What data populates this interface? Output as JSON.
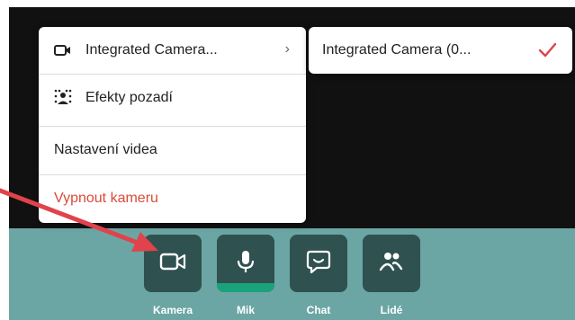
{
  "menu": {
    "items": [
      {
        "label": "Integrated Camera...",
        "icon": "camera-icon",
        "chevron": "›"
      },
      {
        "label": "Efekty pozadí",
        "icon": "background-effects-icon"
      },
      {
        "label": "Nastavení videa"
      },
      {
        "label": "Vypnout kameru"
      }
    ]
  },
  "submenu": {
    "selected_label": "Integrated Camera (0...",
    "check_icon": "checkmark-icon",
    "check_color": "#e0434b"
  },
  "controls": [
    {
      "label": "Kamera",
      "icon": "camera-icon"
    },
    {
      "label": "Mik",
      "icon": "microphone-icon",
      "active": true
    },
    {
      "label": "Chat",
      "icon": "chat-icon"
    },
    {
      "label": "Lidé",
      "icon": "people-icon"
    }
  ],
  "colors": {
    "bar": "#6ba6a4",
    "button_bg": "#2f5150",
    "mic_active": "#1aa37a",
    "danger_text": "#d94a3a",
    "annotation_arrow": "#e0434b"
  }
}
